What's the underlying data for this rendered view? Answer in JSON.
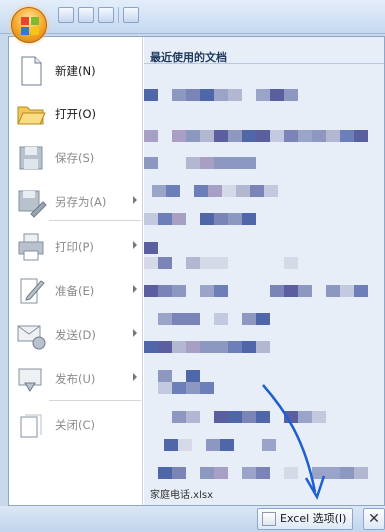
{
  "menu": {
    "items": [
      {
        "label": "新建(N)",
        "icon": "new-document-icon",
        "enabled": true,
        "submenu": false
      },
      {
        "label": "打开(O)",
        "icon": "open-folder-icon",
        "enabled": true,
        "submenu": false
      },
      {
        "label": "保存(S)",
        "icon": "save-icon",
        "enabled": false,
        "submenu": false
      },
      {
        "label": "另存为(A)",
        "icon": "save-as-icon",
        "enabled": false,
        "submenu": true
      },
      {
        "label": "打印(P)",
        "icon": "print-icon",
        "enabled": false,
        "submenu": true
      },
      {
        "label": "准备(E)",
        "icon": "prepare-icon",
        "enabled": false,
        "submenu": true
      },
      {
        "label": "发送(D)",
        "icon": "send-icon",
        "enabled": false,
        "submenu": true
      },
      {
        "label": "发布(U)",
        "icon": "publish-icon",
        "enabled": false,
        "submenu": true
      },
      {
        "label": "关闭(C)",
        "icon": "close-document-icon",
        "enabled": false,
        "submenu": false
      }
    ]
  },
  "recent": {
    "title": "最近使用的文档",
    "bottom_item": "家庭电话.xlsx"
  },
  "footer": {
    "options_label": "Excel 选项(I)",
    "exit_label": "✕"
  },
  "colors": {
    "accent": "#1f5fd1"
  }
}
